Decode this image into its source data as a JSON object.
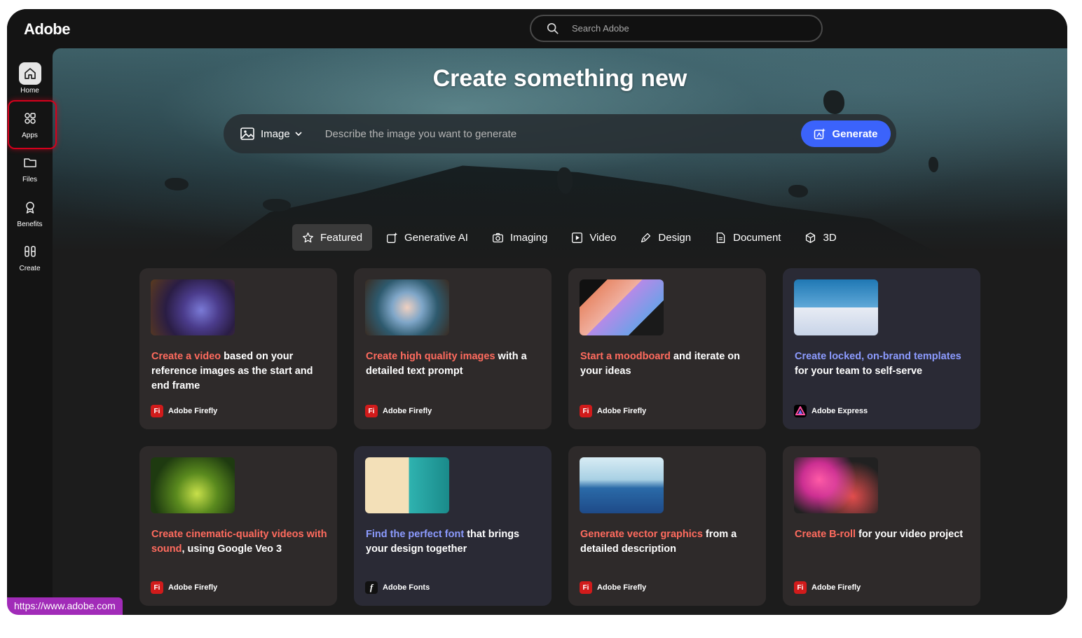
{
  "app": {
    "logo": "Adobe"
  },
  "search": {
    "placeholder": "Search Adobe"
  },
  "sidebar": {
    "items": [
      {
        "label": "Home",
        "icon": "home-icon"
      },
      {
        "label": "Apps",
        "icon": "apps-icon"
      },
      {
        "label": "Files",
        "icon": "folder-icon"
      },
      {
        "label": "Benefits",
        "icon": "award-icon"
      },
      {
        "label": "Create",
        "icon": "create-icon"
      }
    ]
  },
  "hero": {
    "title": "Create something new",
    "mode_label": "Image",
    "prompt_placeholder": "Describe the image you want to generate",
    "generate_label": "Generate"
  },
  "tabs": [
    {
      "label": "Featured",
      "icon": "star-icon"
    },
    {
      "label": "Generative AI",
      "icon": "generative-ai-icon"
    },
    {
      "label": "Imaging",
      "icon": "camera-icon"
    },
    {
      "label": "Video",
      "icon": "video-icon"
    },
    {
      "label": "Design",
      "icon": "pen-icon"
    },
    {
      "label": "Document",
      "icon": "document-icon"
    },
    {
      "label": "3D",
      "icon": "cube-icon"
    }
  ],
  "cards": [
    {
      "highlight": "Create a video",
      "rest": " based on your reference images as the start and end frame",
      "app": "Adobe Firefly"
    },
    {
      "highlight": "Create high quality images",
      "rest": " with a detailed text prompt",
      "app": "Adobe Firefly"
    },
    {
      "highlight": "Start a moodboard",
      "rest": " and iterate on your ideas",
      "app": "Adobe Firefly"
    },
    {
      "highlight": "Create locked, on-brand templates",
      "rest": " for your team to self-serve",
      "app": "Adobe Express"
    },
    {
      "highlight": "Create cinematic-quality videos with sound",
      "rest": ", using Google Veo 3",
      "app": "Adobe Firefly"
    },
    {
      "highlight": "Find the perfect font",
      "rest": " that brings your design together",
      "app": "Adobe Fonts"
    },
    {
      "highlight": "Generate vector graphics",
      "rest": " from a detailed description",
      "app": "Adobe Firefly"
    },
    {
      "highlight": "Create B-roll",
      "rest": " for your video project",
      "app": "Adobe Firefly"
    }
  ],
  "app_badges": {
    "firefly": "Fi",
    "fonts": "f"
  },
  "status_bar": {
    "url": "https://www.adobe.com"
  },
  "colors": {
    "accent_blue": "#3b63fb",
    "highlight_red": "#ff6b5e",
    "highlight_blue": "#8c9bff",
    "firefly_red": "#d11b1b"
  }
}
